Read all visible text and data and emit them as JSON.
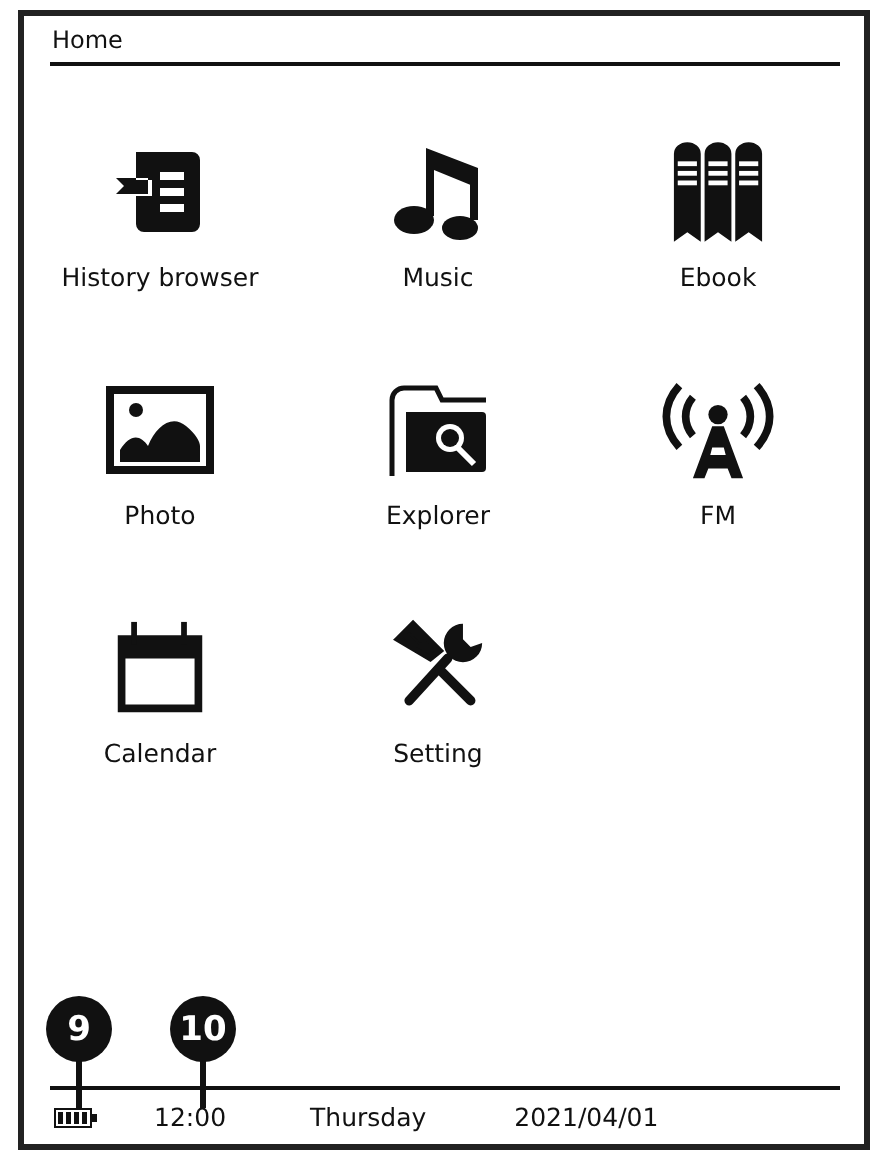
{
  "header": {
    "title": "Home"
  },
  "apps": [
    {
      "label": "History browser",
      "kind": "history"
    },
    {
      "label": "Music",
      "kind": "music"
    },
    {
      "label": "Ebook",
      "kind": "ebook"
    },
    {
      "label": "Photo",
      "kind": "photo"
    },
    {
      "label": "Explorer",
      "kind": "explorer"
    },
    {
      "label": "FM",
      "kind": "fm"
    },
    {
      "label": "Calendar",
      "kind": "calendar"
    },
    {
      "label": "Setting",
      "kind": "setting"
    }
  ],
  "callouts": [
    {
      "label": "9"
    },
    {
      "label": "10"
    }
  ],
  "status_bar": {
    "time": "12:00",
    "day": "Thursday",
    "date": "2021/04/01"
  }
}
